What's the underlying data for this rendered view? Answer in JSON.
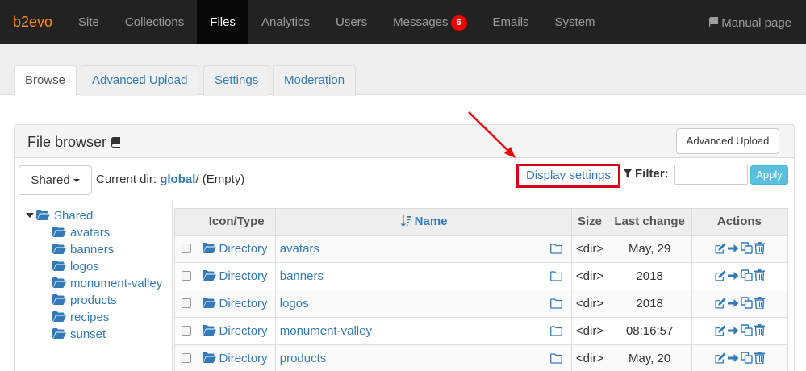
{
  "nav": {
    "brand": "b2evo",
    "items": [
      {
        "label": "Site"
      },
      {
        "label": "Collections"
      },
      {
        "label": "Files"
      },
      {
        "label": "Analytics"
      },
      {
        "label": "Users"
      },
      {
        "label": "Messages",
        "badge": "6"
      },
      {
        "label": "Emails"
      },
      {
        "label": "System"
      }
    ],
    "manual_label": "Manual page"
  },
  "tabs": [
    {
      "label": "Browse"
    },
    {
      "label": "Advanced Upload"
    },
    {
      "label": "Settings"
    },
    {
      "label": "Moderation"
    }
  ],
  "panel": {
    "title": "File browser",
    "advanced_upload_label": "Advanced Upload"
  },
  "toolbar": {
    "root_button": "Shared",
    "current_dir_label": "Current dir:",
    "current_dir_link": "global",
    "current_dir_suffix": "/ (Empty)",
    "display_settings": "Display settings",
    "filter_label": "Filter:",
    "filter_value": "",
    "apply_label": "Apply"
  },
  "tree": {
    "root": "Shared",
    "children": [
      "avatars",
      "banners",
      "logos",
      "monument-valley",
      "products",
      "recipes",
      "sunset"
    ]
  },
  "table": {
    "headers": {
      "icon_type": "Icon/Type",
      "name": "Name",
      "size": "Size",
      "last_change": "Last change",
      "actions": "Actions"
    },
    "rows": [
      {
        "type": "Directory",
        "name": "avatars",
        "size": "<dir>",
        "last_change": "May, 29"
      },
      {
        "type": "Directory",
        "name": "banners",
        "size": "<dir>",
        "last_change": "2018"
      },
      {
        "type": "Directory",
        "name": "logos",
        "size": "<dir>",
        "last_change": "2018"
      },
      {
        "type": "Directory",
        "name": "monument-valley",
        "size": "<dir>",
        "last_change": "08:16:57"
      },
      {
        "type": "Directory",
        "name": "products",
        "size": "<dir>",
        "last_change": "May, 20"
      }
    ]
  },
  "colors": {
    "link": "#337ab7",
    "brand": "#ff8c0f",
    "highlight_box": "#d9001b",
    "apply_button": "#5bc0de"
  }
}
